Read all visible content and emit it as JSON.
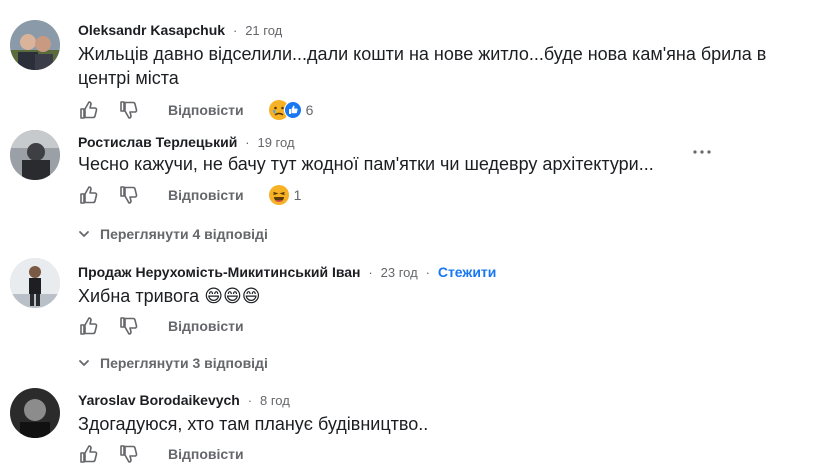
{
  "comments": [
    {
      "author": "Oleksandr Kasapchuk",
      "time": "21 год",
      "text_line1": "Жильців давно відселили...дали кошти на нове житло...буде нова кам'яна брила в",
      "text_line2": "центрі міста",
      "reply_label": "Відповісти",
      "reaction_count": "6",
      "reaction_icons": [
        "sad-reaction",
        "like-reaction"
      ]
    },
    {
      "author": "Ростислав Терлецький",
      "time": "19 год",
      "text": "Чесно кажучи, не бачу тут жодної пам'ятки чи шедевру архітектури...",
      "reply_label": "Відповісти",
      "reaction_count": "1",
      "reaction_icons": [
        "haha-reaction"
      ],
      "replies_toggle": "Переглянути 4 відповіді"
    },
    {
      "author": "Продаж Нерухомість-Микитинський Іван",
      "time": "23 год",
      "follow": "Стежити",
      "text": "Хибна тривога",
      "emojis": "😄😄😄",
      "reply_label": "Відповісти",
      "replies_toggle": "Переглянути 3 відповіді"
    },
    {
      "author": "Yaroslav Borodaikevych",
      "time": "8 год",
      "text": "Здогадуюся, хто там планує будівництво..",
      "reply_label": "Відповісти"
    }
  ],
  "separator": "·",
  "colors": {
    "text": "#1c1e21",
    "muted": "#65676b",
    "link": "#1877f2",
    "like_blue": "#1877f2",
    "reaction_yellow": "#f7b125"
  }
}
